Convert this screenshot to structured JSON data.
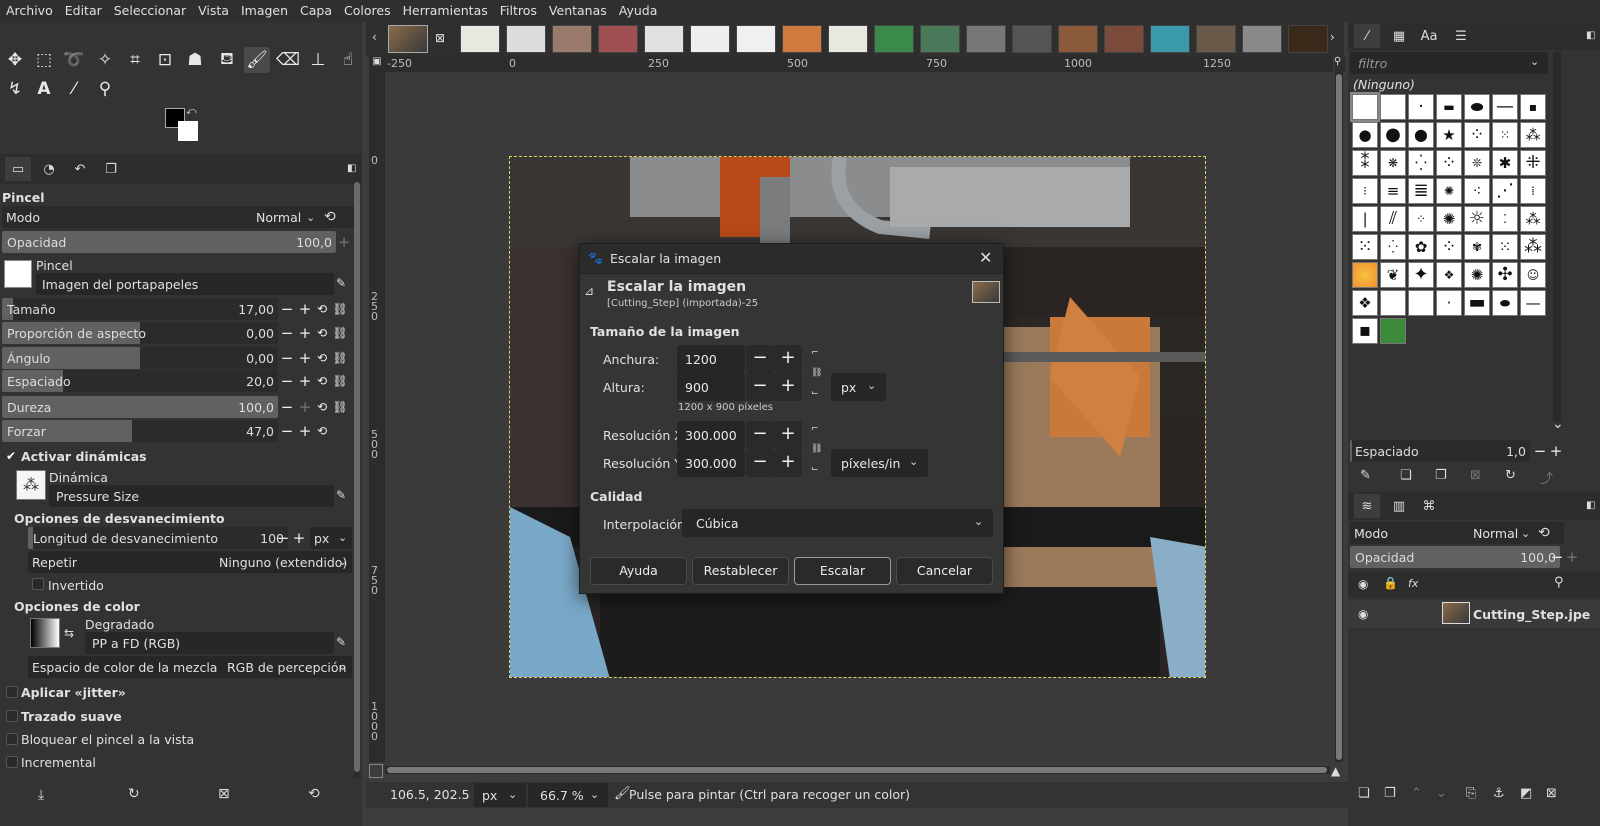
{
  "menu": [
    "Archivo",
    "Editar",
    "Seleccionar",
    "Vista",
    "Imagen",
    "Capa",
    "Colores",
    "Herramientas",
    "Filtros",
    "Ventanas",
    "Ayuda"
  ],
  "tool_options": {
    "title": "Pincel",
    "mode_label": "Modo",
    "mode_value": "Normal",
    "opacity_label": "Opacidad",
    "opacity_value": "100,0",
    "brush_label": "Pincel",
    "brush_name": "Imagen del portapapeles",
    "size_label": "Tamaño",
    "size_value": "17,00",
    "aspect_label": "Proporción de aspecto",
    "aspect_value": "0,00",
    "angle_label": "Ángulo",
    "angle_value": "0,00",
    "spacing_label": "Espaciado",
    "spacing_value": "20,0",
    "hardness_label": "Dureza",
    "hardness_value": "100,0",
    "force_label": "Forzar",
    "force_value": "47,0",
    "dynamics_enable": "Activar dinámicas",
    "dynamics_label": "Dinámica",
    "dynamics_value": "Pressure Size",
    "fade_title": "Opciones de desvanecimiento",
    "fade_length_label": "Longitud de desvanecimiento",
    "fade_length_value": "100",
    "fade_unit": "px",
    "repeat_label": "Repetir",
    "repeat_value": "Ninguno (extendido)",
    "reverse_label": "Invertido",
    "color_title": "Opciones de color",
    "gradient_label": "Degradado",
    "gradient_value": "PP a FD (RGB)",
    "blend_space_label": "Espacio de color de la mezcla",
    "blend_space_value": "RGB de percepción",
    "jitter_label": "Aplicar «jitter»",
    "smooth_label": "Trazado suave",
    "lock_label": "Bloquear el pincel a la vista",
    "incremental_label": "Incremental"
  },
  "rulers": {
    "h": [
      "-250",
      "0",
      "250",
      "500",
      "750",
      "1000",
      "1250"
    ],
    "v": [
      "0",
      "250",
      "500",
      "750",
      "1000"
    ]
  },
  "status": {
    "coords": "106.5, 202.5",
    "unit": "px",
    "zoom": "66.7 %",
    "message": "Pulse para pintar (Ctrl para recoger un color)"
  },
  "right": {
    "filter_placeholder": "filtro",
    "tag": "(Ninguno)",
    "spacing_label": "Espaciado",
    "spacing_value": "1,0",
    "mode_label": "Modo",
    "mode_value": "Normal",
    "opacity_label": "Opacidad",
    "opacity_value": "100,0",
    "layer_name": "Cutting_Step.jpe"
  },
  "dialog": {
    "window_title": "Escalar la imagen",
    "heading": "Escalar la imagen",
    "subheading": "[Cutting_Step] (importada)-25",
    "size_section": "Tamaño de la imagen",
    "width_label": "Anchura:",
    "width_value": "1200",
    "height_label": "Altura:",
    "height_value": "900",
    "size_unit": "px",
    "size_info": "1200 x 900 píxeles",
    "xres_label": "Resolución X:",
    "xres_value": "300.000",
    "yres_label": "Resolución Y:",
    "yres_value": "300.000",
    "res_unit": "píxeles/in",
    "quality_section": "Calidad",
    "interp_label": "Interpolación:",
    "interp_value": "Cúbica",
    "buttons": {
      "help": "Ayuda",
      "reset": "Restablecer",
      "scale": "Escalar",
      "cancel": "Cancelar"
    }
  }
}
